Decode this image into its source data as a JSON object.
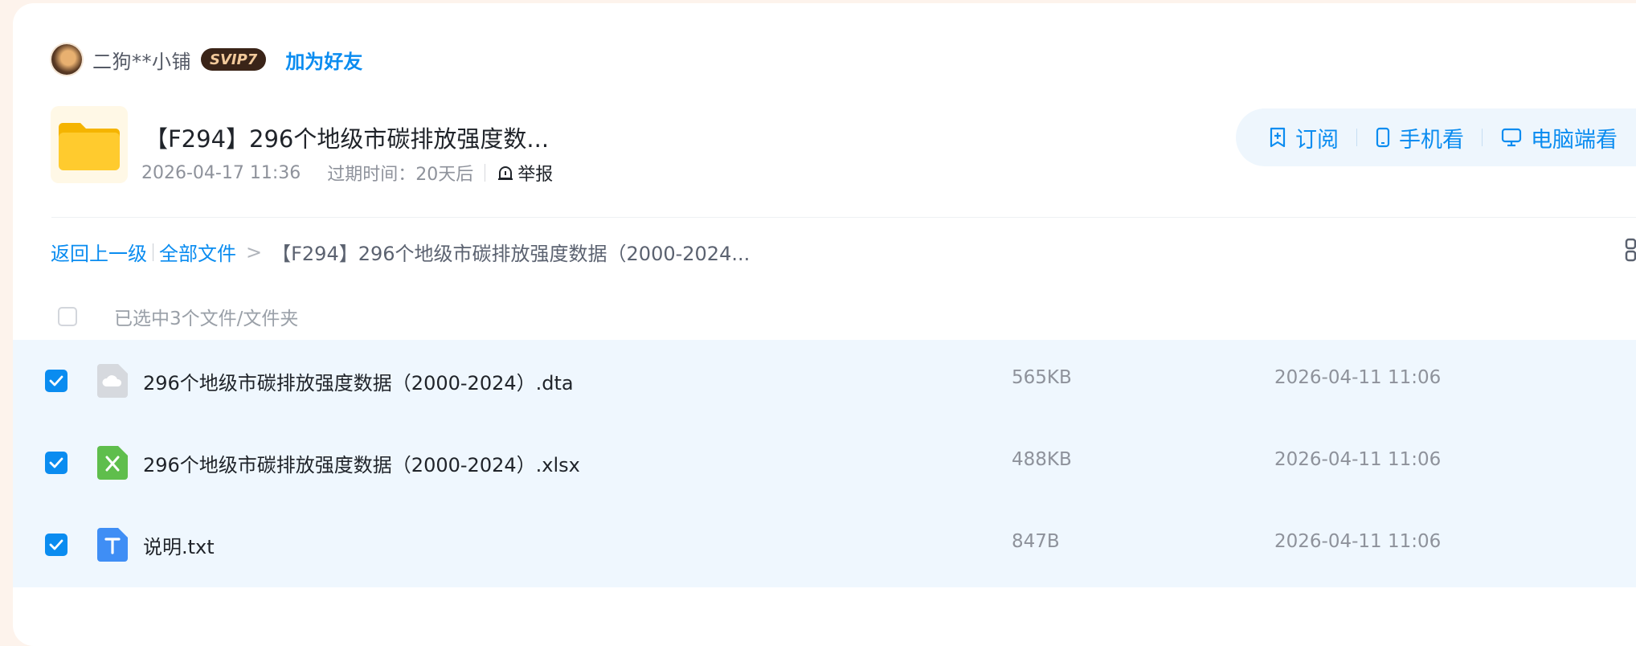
{
  "user": {
    "name": "二狗**小铺",
    "vip_badge": "SVIP7",
    "add_friend": "加为好友"
  },
  "share": {
    "title": "【F294】296个地级市碳排放强度数...",
    "date": "2026-04-17 11:36",
    "expire": "过期时间：20天后",
    "report": "举报"
  },
  "actions": {
    "subscribe": "订阅",
    "mobile": "手机看",
    "pc": "电脑端看"
  },
  "breadcrumb": {
    "back": "返回上一级",
    "all_files": "全部文件",
    "separator": ">",
    "current": "【F294】296个地级市碳排放强度数据（2000-2024..."
  },
  "selection": {
    "summary": "已选中3个文件/文件夹"
  },
  "files": [
    {
      "name": "296个地级市碳排放强度数据（2000-2024）.dta",
      "size": "565KB",
      "date": "2026-04-11 11:06",
      "icon": "cloud-file-icon",
      "checked": true
    },
    {
      "name": "296个地级市碳排放强度数据（2000-2024）.xlsx",
      "size": "488KB",
      "date": "2026-04-11 11:06",
      "icon": "excel-file-icon",
      "checked": true
    },
    {
      "name": "说明.txt",
      "size": "847B",
      "date": "2026-04-11 11:06",
      "icon": "text-file-icon",
      "checked": true
    }
  ],
  "colors": {
    "accent": "#0a8cf0",
    "selected_row_bg": "#eff7fe",
    "page_bg": "#fdf3ec"
  }
}
